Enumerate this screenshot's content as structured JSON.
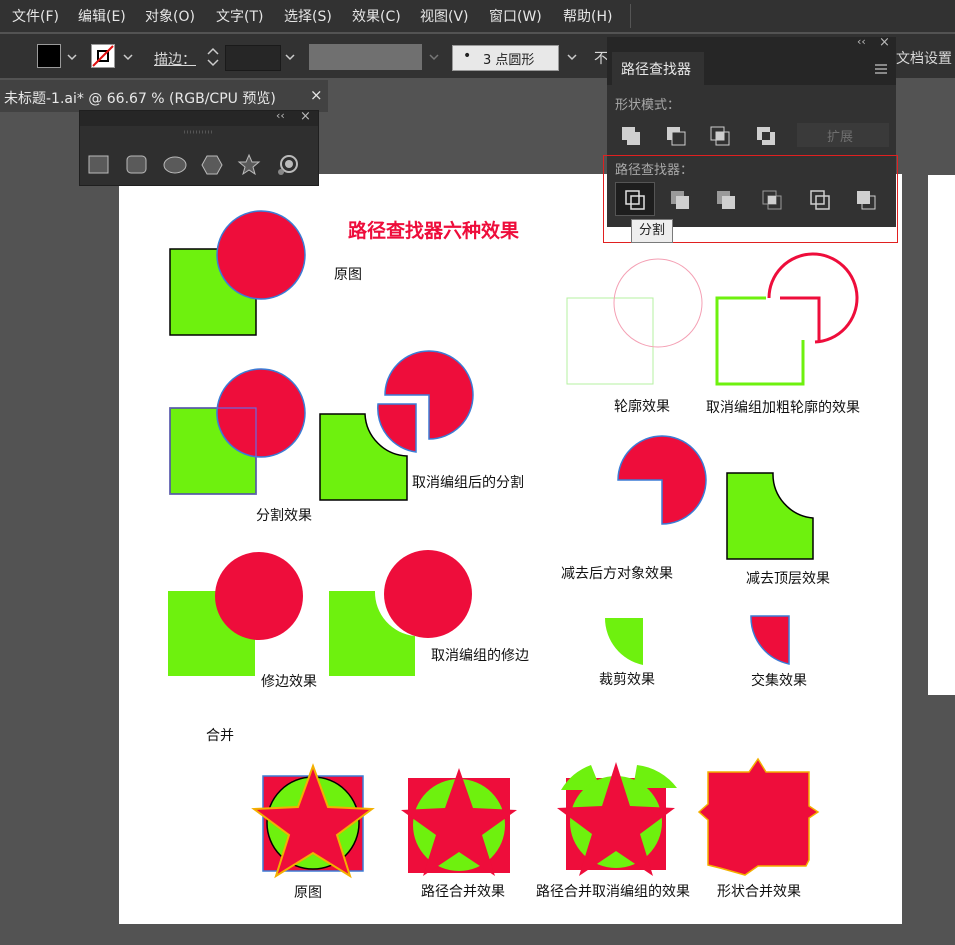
{
  "menubar": {
    "items": [
      "文件(F)",
      "编辑(E)",
      "对象(O)",
      "文字(T)",
      "选择(S)",
      "效果(C)",
      "视图(V)",
      "窗口(W)",
      "帮助(H)"
    ]
  },
  "control_bar": {
    "stroke_label": "描边：",
    "brush_label": "3 点圆形",
    "truncated_label": "不",
    "doc_setup_label": "文档设置"
  },
  "document_tab": {
    "label": "未标题-1.ai* @ 66.67 % (RGB/CPU 预览)",
    "close": "×"
  },
  "pathfinder_panel": {
    "title": "路径查找器",
    "shape_modes_label": "形状模式：",
    "expand_label": "扩展",
    "pathfinders_label": "路径查找器：",
    "tooltip": "分割",
    "collapse": "‹‹",
    "close": "×"
  },
  "tool_panel": {
    "collapse": "‹‹",
    "close": "×"
  },
  "artboard": {
    "title": "路径查找器六种效果",
    "labels": {
      "original": "原图",
      "divide": "分割效果",
      "divide_ungrouped": "取消编组后的分割",
      "trim": "修边效果",
      "trim_ungrouped": "取消编组的修边",
      "merge": "合并",
      "outline": "轮廓效果",
      "outline_thick": "取消编组加粗轮廓的效果",
      "minus_back": "减去后方对象效果",
      "minus_front": "减去顶层效果",
      "crop": "裁剪效果",
      "intersect": "交集效果",
      "merge_original": "原图",
      "merge_path": "路径合并效果",
      "merge_path_ungrouped": "路径合并取消编组的效果",
      "merge_shape": "形状合并效果"
    }
  },
  "colors": {
    "green": "#6ef10e",
    "red": "#ee0d3b",
    "stroke_blue": "#3b7cd6",
    "panel_bg": "#323232",
    "canvas_bg": "#535353",
    "highlight_red": "#e02020"
  }
}
